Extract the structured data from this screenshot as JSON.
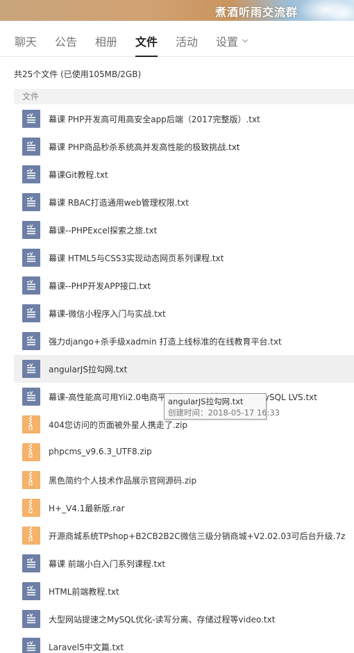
{
  "banner": {
    "group_name": "煮酒听雨交流群"
  },
  "tabs": [
    {
      "label": "聊天",
      "active": false
    },
    {
      "label": "公告",
      "active": false
    },
    {
      "label": "相册",
      "active": false
    },
    {
      "label": "文件",
      "active": true
    },
    {
      "label": "活动",
      "active": false
    },
    {
      "label": "设置",
      "active": false,
      "dropdown": true
    }
  ],
  "summary": "共25个文件 (已使用105MB/2GB)",
  "section_header": "文件",
  "files": [
    {
      "name": "幕课 PHP开发高可用高安全app后端（2017完整版）.txt",
      "type": "txt"
    },
    {
      "name": "幕课  PHP商品秒杀系统高并发高性能的极致挑战.txt",
      "type": "txt"
    },
    {
      "name": "幕课Git教程.txt",
      "type": "txt"
    },
    {
      "name": "幕课 RBAC打造通用web管理权限.txt",
      "type": "txt"
    },
    {
      "name": "幕课--PHPExcel探索之旅.txt",
      "type": "txt"
    },
    {
      "name": "幕课 HTML5与CSS3实现动态网页系列课程.txt",
      "type": "txt"
    },
    {
      "name": "幕课--PHP开发APP接口.txt",
      "type": "txt"
    },
    {
      "name": "幕课-微信小程序入门与实战.txt",
      "type": "txt"
    },
    {
      "name": "强力django+杀手级xadmin 打造上线标准的在线教育平台.txt",
      "type": "txt"
    },
    {
      "name": "angularJS拉勾网.txt",
      "type": "txt",
      "hovered": true
    },
    {
      "name": "幕课-高性能高可用Yii2.0电商平台 仿京东商城 高级组件 MySQL LVS.txt",
      "type": "txt"
    },
    {
      "name": "404您访问的页面被外星人携走了.zip",
      "type": "zip"
    },
    {
      "name": "phpcms_v9.6.3_UTF8.zip",
      "type": "zip"
    },
    {
      "name": "黑色简约个人技术作品展示官网源码.zip",
      "type": "zip"
    },
    {
      "name": "H+_V4.1最新版.rar",
      "type": "zip"
    },
    {
      "name": "开源商城系统TPshop+B2CB2B2C微信三级分销商城+V2.02.03可后台升级.7z",
      "type": "zip"
    },
    {
      "name": "幕课  前端小白入门系列课程.txt",
      "type": "txt"
    },
    {
      "name": "HTML前端教程.txt",
      "type": "txt"
    },
    {
      "name": "大型网站提速之MySQL优化-读写分离、存储过程等video.txt",
      "type": "txt"
    },
    {
      "name": "Laravel5中文篇.txt",
      "type": "txt"
    }
  ],
  "tooltip": {
    "name": "angularJS拉勾网.txt",
    "created": "创建时间：2018-05-17 16:33"
  },
  "colors": {
    "txt_icon": "#6d7fa6",
    "zip_icon": "#f4b26b",
    "hover_row": "#f0f0f0"
  }
}
